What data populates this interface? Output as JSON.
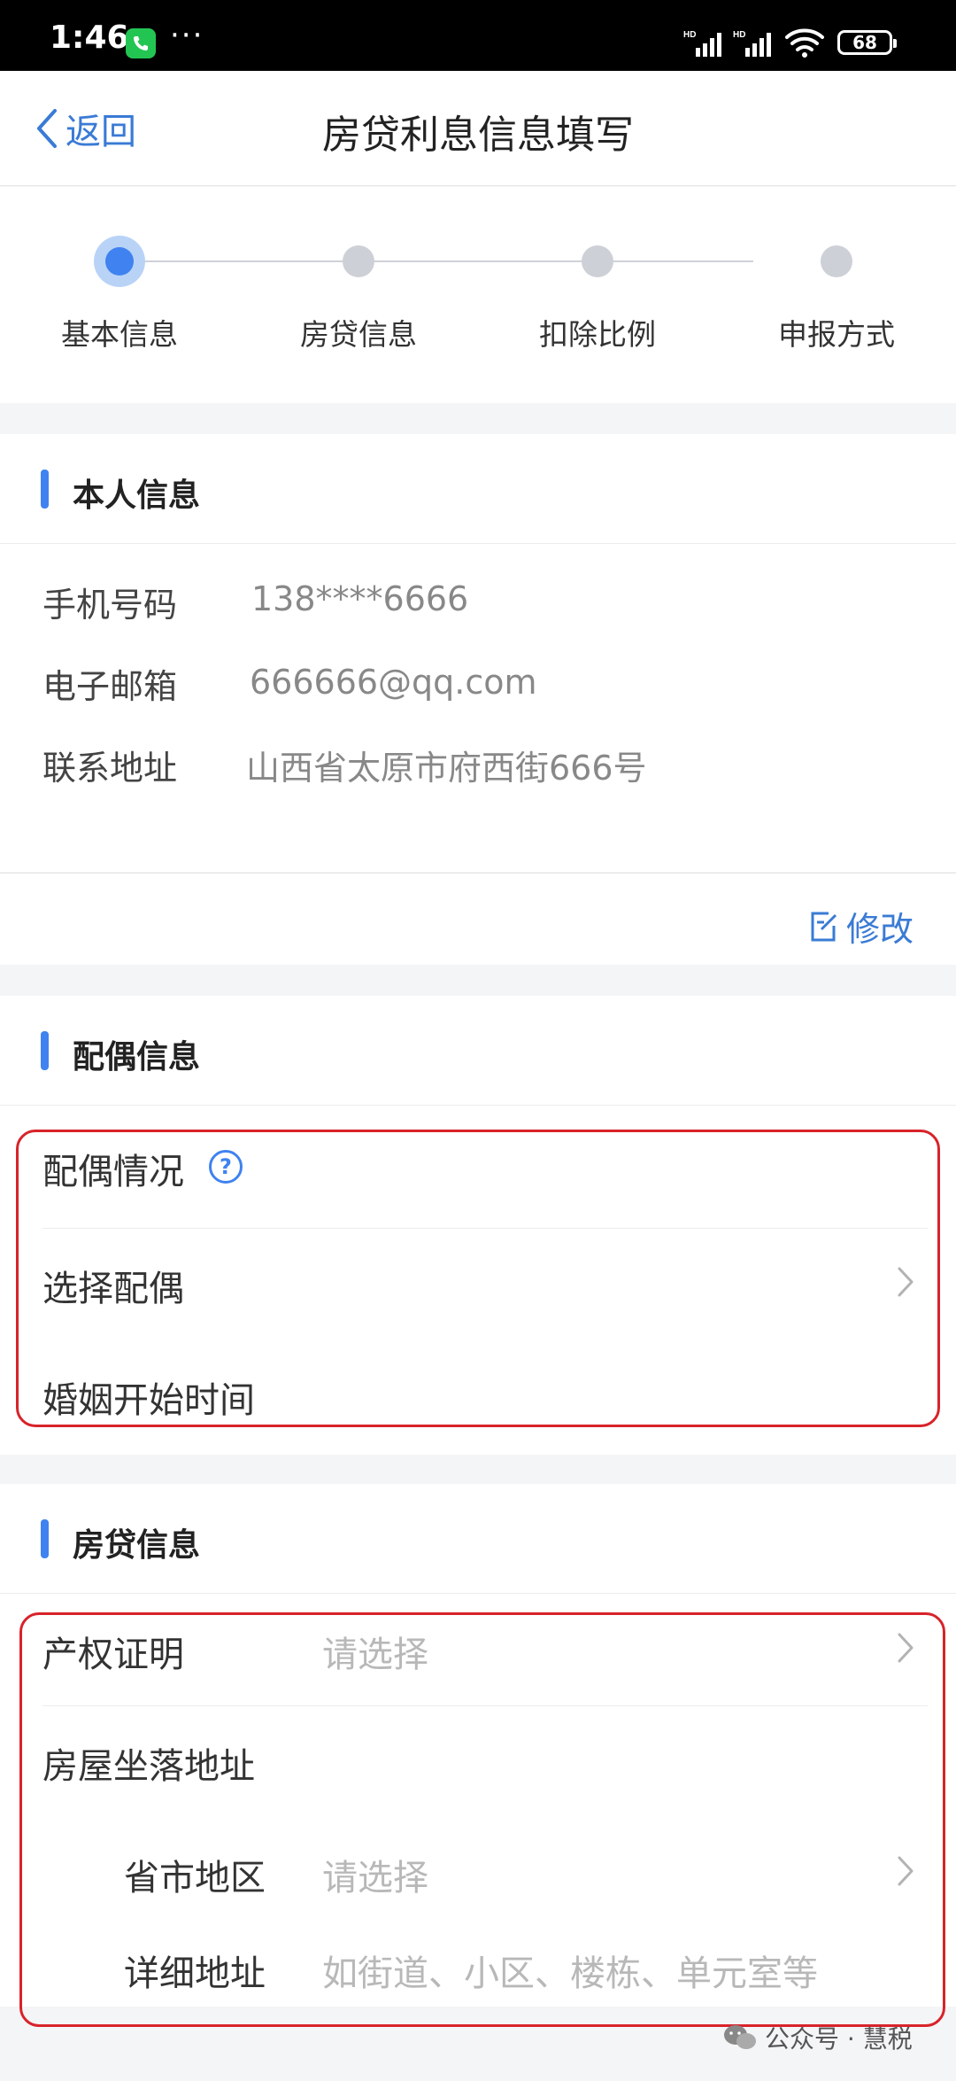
{
  "status_bar": {
    "time": "1:46",
    "dots": "···",
    "battery": "68"
  },
  "nav": {
    "back_label": "返回",
    "title": "房贷利息信息填写"
  },
  "steps": [
    {
      "label": "基本信息",
      "active": true
    },
    {
      "label": "房贷信息",
      "active": false
    },
    {
      "label": "扣除比例",
      "active": false
    },
    {
      "label": "申报方式",
      "active": false
    }
  ],
  "personal": {
    "section_title": "本人信息",
    "phone_label": "手机号码",
    "phone_value": "138****6666",
    "email_label": "电子邮箱",
    "email_value": "666666@qq.com",
    "address_label": "联系地址",
    "address_value": "山西省太原市府西街666号",
    "edit_label": "修改"
  },
  "spouse": {
    "section_title": "配偶信息",
    "status_label": "配偶情况",
    "select_label": "选择配偶",
    "marriage_label": "婚姻开始时间"
  },
  "mortgage": {
    "section_title": "房贷信息",
    "certificate_label": "产权证明",
    "certificate_placeholder": "请选择",
    "location_label": "房屋坐落地址",
    "region_label": "省市地区",
    "region_placeholder": "请选择",
    "detail_label": "详细地址",
    "detail_placeholder": "如街道、小区、楼栋、单元室等"
  },
  "watermark": "公众号 · 慧税",
  "colors": {
    "accent": "#3f82f0",
    "highlight_box": "#d8232a",
    "status_bar_bg": "#000000",
    "phone_app": "#23c552"
  }
}
